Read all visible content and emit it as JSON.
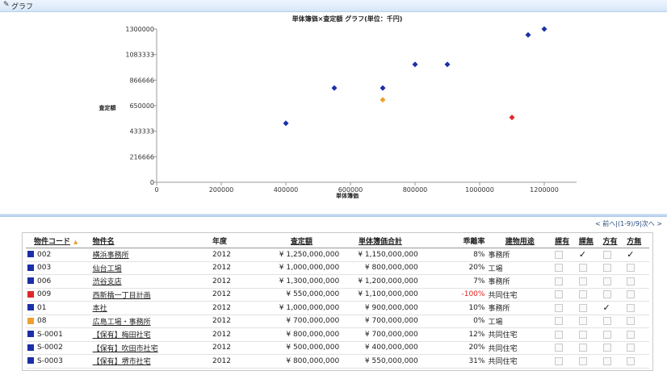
{
  "header": {
    "title": "グラフ",
    "icon": "pencil-icon"
  },
  "chart_data": {
    "type": "scatter",
    "title": "単体簿価×査定額 グラフ(単位：千円)",
    "xlabel": "単体簿価",
    "ylabel": "査定額",
    "xlim": [
      0,
      1300000
    ],
    "ylim": [
      0,
      1300000
    ],
    "xticks": [
      0,
      200000,
      400000,
      600000,
      800000,
      1000000,
      1200000
    ],
    "yticks": [
      0,
      216666,
      433333,
      650000,
      866666,
      1083333,
      1300000
    ],
    "xtick_labels": [
      "0",
      "200000",
      "400000",
      "600000",
      "800000",
      "1000000",
      "1200000"
    ],
    "ytick_labels": [
      "0",
      "216666",
      "433333",
      "650000",
      "866666",
      "1083333",
      "1300000"
    ],
    "points": [
      {
        "x": 400000,
        "y": 500000,
        "color": "#1a2fa8"
      },
      {
        "x": 550000,
        "y": 800000,
        "color": "#1a2fa8"
      },
      {
        "x": 700000,
        "y": 800000,
        "color": "#1a2fa8"
      },
      {
        "x": 700000,
        "y": 700000,
        "color": "#f0a030"
      },
      {
        "x": 800000,
        "y": 1000000,
        "color": "#1a2fa8"
      },
      {
        "x": 900000,
        "y": 1000000,
        "color": "#1a2fa8"
      },
      {
        "x": 1100000,
        "y": 550000,
        "color": "#e02828"
      },
      {
        "x": 1150000,
        "y": 1250000,
        "color": "#1a2fa8"
      },
      {
        "x": 1200000,
        "y": 1300000,
        "color": "#1a2fa8"
      }
    ]
  },
  "pager": {
    "text": "< 前へ|(1-9)/9|次へ >"
  },
  "table": {
    "columns": [
      "物件コード",
      "物件名",
      "年度",
      "査定額",
      "単体簿価合計",
      "乖離率",
      "建物用途",
      "課有",
      "課無",
      "方有",
      "方無"
    ],
    "rows": [
      {
        "code": "002",
        "name": "横浜事務所",
        "year": "2012",
        "assessed": "¥ 1,250,000,000",
        "book": "¥ 1,150,000,000",
        "rate": "8%",
        "use": "事務所",
        "color": "#1a2fa8",
        "neg": false,
        "checks": [
          false,
          true,
          false,
          true
        ]
      },
      {
        "code": "003",
        "name": "仙台工場",
        "year": "2012",
        "assessed": "¥ 1,000,000,000",
        "book": "¥ 800,000,000",
        "rate": "20%",
        "use": "工場",
        "color": "#1a2fa8",
        "neg": false,
        "checks": [
          false,
          false,
          false,
          false
        ]
      },
      {
        "code": "006",
        "name": "渋谷支店",
        "year": "2012",
        "assessed": "¥ 1,300,000,000",
        "book": "¥ 1,200,000,000",
        "rate": "7%",
        "use": "事務所",
        "color": "#1a2fa8",
        "neg": false,
        "checks": [
          false,
          false,
          false,
          false
        ]
      },
      {
        "code": "009",
        "name": "西新橋一丁目計画",
        "year": "2012",
        "assessed": "¥ 550,000,000",
        "book": "¥ 1,100,000,000",
        "rate": "-100%",
        "use": "共同住宅",
        "color": "#e02828",
        "neg": true,
        "checks": [
          false,
          false,
          false,
          false
        ]
      },
      {
        "code": "01",
        "name": "本社",
        "year": "2012",
        "assessed": "¥ 1,000,000,000",
        "book": "¥ 900,000,000",
        "rate": "10%",
        "use": "事務所",
        "color": "#1a2fa8",
        "neg": false,
        "checks": [
          false,
          false,
          true,
          false
        ]
      },
      {
        "code": "08",
        "name": "広島工場・事務所",
        "year": "2012",
        "assessed": "¥ 700,000,000",
        "book": "¥ 700,000,000",
        "rate": "0%",
        "use": "工場",
        "color": "#f0a030",
        "neg": false,
        "checks": [
          false,
          false,
          false,
          false
        ]
      },
      {
        "code": "S-0001",
        "name": "【保有】梅田社宅",
        "year": "2012",
        "assessed": "¥ 800,000,000",
        "book": "¥ 700,000,000",
        "rate": "12%",
        "use": "共同住宅",
        "color": "#1a2fa8",
        "neg": false,
        "checks": [
          false,
          false,
          false,
          false
        ]
      },
      {
        "code": "S-0002",
        "name": "【保有】吹田市社宅",
        "year": "2012",
        "assessed": "¥ 500,000,000",
        "book": "¥ 400,000,000",
        "rate": "20%",
        "use": "共同住宅",
        "color": "#1a2fa8",
        "neg": false,
        "checks": [
          false,
          false,
          false,
          false
        ]
      },
      {
        "code": "S-0003",
        "name": "【保有】堺市社宅",
        "year": "2012",
        "assessed": "¥ 800,000,000",
        "book": "¥ 550,000,000",
        "rate": "31%",
        "use": "共同住宅",
        "color": "#1a2fa8",
        "neg": false,
        "checks": [
          false,
          false,
          false,
          false
        ]
      }
    ]
  }
}
